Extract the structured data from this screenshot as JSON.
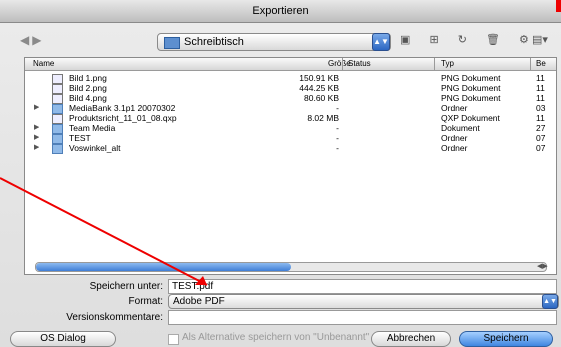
{
  "window": {
    "title": "Exportieren"
  },
  "toolbar": {
    "location": "Schreibtisch"
  },
  "columns": [
    "Name",
    "Größe",
    "Status",
    "Typ",
    "Be"
  ],
  "files": [
    {
      "name": "Bild 1.png",
      "size": "150.91 KB",
      "status": "",
      "type": "PNG Dokument",
      "be": "11",
      "kind": "file"
    },
    {
      "name": "Bild 2.png",
      "size": "444.25 KB",
      "status": "",
      "type": "PNG Dokument",
      "be": "11",
      "kind": "file"
    },
    {
      "name": "Bild 4.png",
      "size": "80.60 KB",
      "status": "",
      "type": "PNG Dokument",
      "be": "11",
      "kind": "file"
    },
    {
      "name": "MediaBank 3.1p1 20070302",
      "size": "-",
      "status": "",
      "type": "Ordner",
      "be": "03",
      "kind": "folder"
    },
    {
      "name": "Produktsricht_11_01_08.qxp",
      "size": "8.02 MB",
      "status": "",
      "type": "QXP Dokument",
      "be": "11",
      "kind": "file"
    },
    {
      "name": "Team Media",
      "size": "-",
      "status": "",
      "type": "Dokument",
      "be": "27",
      "kind": "folder"
    },
    {
      "name": "TEST",
      "size": "-",
      "status": "",
      "type": "Ordner",
      "be": "07",
      "kind": "folder"
    },
    {
      "name": "Voswinkel_alt",
      "size": "-",
      "status": "",
      "type": "Ordner",
      "be": "07",
      "kind": "folder"
    }
  ],
  "form": {
    "save_as_label": "Speichern unter:",
    "save_as_value": "TEST.pdf",
    "format_label": "Format:",
    "format_value": "Adobe PDF",
    "comments_label": "Versionskommentare:",
    "comments_value": ""
  },
  "footer": {
    "os_dialog": "OS Dialog",
    "alternative": "Als Alternative speichern von \"Unbenannt\"",
    "cancel": "Abbrechen",
    "save": "Speichern"
  }
}
